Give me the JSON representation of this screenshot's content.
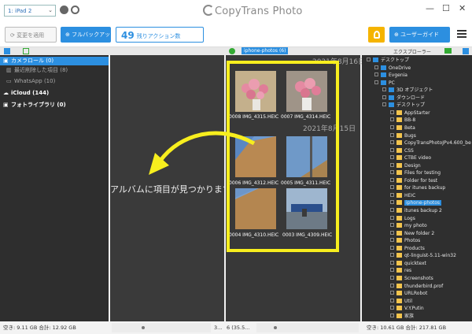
{
  "app": {
    "device": "1: iPad 2",
    "logo": "CopyTrans Photo",
    "window_controls": [
      "—",
      "☐",
      "✕"
    ]
  },
  "toolbar": {
    "apply_label": "変更を適用",
    "backup_label": "フルバックアップ",
    "actions_count": "49",
    "actions_label": "残りアクション数",
    "guide_label": "ユーザーガイド"
  },
  "panels": {
    "photos_tab": "iphone-photos (6)",
    "explorer_label": "エクスプローラー"
  },
  "left_nav": {
    "items": [
      {
        "label": "カメラロール (0)",
        "icon": "camera-icon",
        "selected": true
      },
      {
        "label": "最近削除した項目 (8)",
        "icon": "trash-icon",
        "selected": false
      },
      {
        "label": "WhatsApp (10)",
        "icon": "folder-icon",
        "selected": false
      },
      {
        "label": "iCloud (144)",
        "icon": "cloud-icon",
        "selected": false
      },
      {
        "label": "フォトライブラリ (0)",
        "icon": "camera-icon",
        "selected": false
      }
    ]
  },
  "albums": {
    "empty_message": "アルバムに項目が見つかります"
  },
  "photos": {
    "dates": [
      "2021年8月16日",
      "2021年8月15日"
    ],
    "items": [
      {
        "label": "0008 IMG_4315.HEIC",
        "kind": "roses"
      },
      {
        "label": "0007 IMG_4314.HEIC",
        "kind": "roses"
      },
      {
        "label": "0006 IMG_4312.HEIC",
        "kind": "window"
      },
      {
        "label": "0005 IMG_4311.HEIC",
        "kind": "window"
      },
      {
        "label": "0004 IMG_4310.HEIC",
        "kind": "window"
      },
      {
        "label": "0003 IMG_4309.HEIC",
        "kind": "hall"
      }
    ]
  },
  "tree": {
    "items": [
      {
        "label": "デスクトップ",
        "depth": 0,
        "icon": "desktop-icon"
      },
      {
        "label": "OneDrive",
        "depth": 1,
        "icon": "cloud-icon"
      },
      {
        "label": "Evgenia",
        "depth": 1,
        "icon": "user-icon"
      },
      {
        "label": "PC",
        "depth": 1,
        "icon": "pc-icon"
      },
      {
        "label": "3D オブジェクト",
        "depth": 2,
        "icon": "cube-icon"
      },
      {
        "label": "ダウンロード",
        "depth": 2,
        "icon": "download-icon"
      },
      {
        "label": "デスクトップ",
        "depth": 2,
        "icon": "desktop-icon"
      },
      {
        "label": "AppStarter",
        "depth": 3,
        "icon": "folder-icon"
      },
      {
        "label": "BB-8",
        "depth": 3,
        "icon": "folder-icon"
      },
      {
        "label": "Beta",
        "depth": 3,
        "icon": "folder-icon"
      },
      {
        "label": "Bugs",
        "depth": 3,
        "icon": "folder-icon"
      },
      {
        "label": "CopyTransPhotoJPv4.600_be",
        "depth": 3,
        "icon": "folder-icon"
      },
      {
        "label": "CSS",
        "depth": 3,
        "icon": "folder-icon"
      },
      {
        "label": "CTBE video",
        "depth": 3,
        "icon": "folder-icon"
      },
      {
        "label": "Design",
        "depth": 3,
        "icon": "folder-icon"
      },
      {
        "label": "Files for testing",
        "depth": 3,
        "icon": "folder-icon"
      },
      {
        "label": "Folder for test",
        "depth": 3,
        "icon": "folder-icon"
      },
      {
        "label": "for itunes backup",
        "depth": 3,
        "icon": "folder-icon"
      },
      {
        "label": "HEIC",
        "depth": 3,
        "icon": "folder-icon"
      },
      {
        "label": "iphone-photos",
        "depth": 3,
        "icon": "folder-icon",
        "selected": true
      },
      {
        "label": "itunes backup 2",
        "depth": 3,
        "icon": "folder-icon"
      },
      {
        "label": "Logs",
        "depth": 3,
        "icon": "folder-icon"
      },
      {
        "label": "my photo",
        "depth": 3,
        "icon": "folder-icon"
      },
      {
        "label": "New folder 2",
        "depth": 3,
        "icon": "folder-icon"
      },
      {
        "label": "Photos",
        "depth": 3,
        "icon": "folder-icon"
      },
      {
        "label": "Products",
        "depth": 3,
        "icon": "folder-icon"
      },
      {
        "label": "qt-linguist-5.11-win32",
        "depth": 3,
        "icon": "folder-icon"
      },
      {
        "label": "quicktext",
        "depth": 3,
        "icon": "folder-icon"
      },
      {
        "label": "res",
        "depth": 3,
        "icon": "folder-icon"
      },
      {
        "label": "Screenshots",
        "depth": 3,
        "icon": "folder-icon"
      },
      {
        "label": "thunderbird.prof",
        "depth": 3,
        "icon": "folder-icon"
      },
      {
        "label": "URLRobot",
        "depth": 3,
        "icon": "folder-icon"
      },
      {
        "label": "Util",
        "depth": 3,
        "icon": "folder-icon"
      },
      {
        "label": "V.Y.Putin",
        "depth": 3,
        "icon": "folder-icon"
      },
      {
        "label": "家族",
        "depth": 3,
        "icon": "folder-icon"
      }
    ]
  },
  "status": {
    "device_space": "空き: 9.11 GB 合計: 12.92 GB",
    "albums_count": "3...",
    "photos_count": "6 (35.5...",
    "pc_space": "空き: 10.61 GB 合計: 217.81 GB"
  },
  "colors": {
    "accent": "#2c8fe0",
    "highlight": "#f7ee1e",
    "panel_dark": "#2e2e2e"
  }
}
